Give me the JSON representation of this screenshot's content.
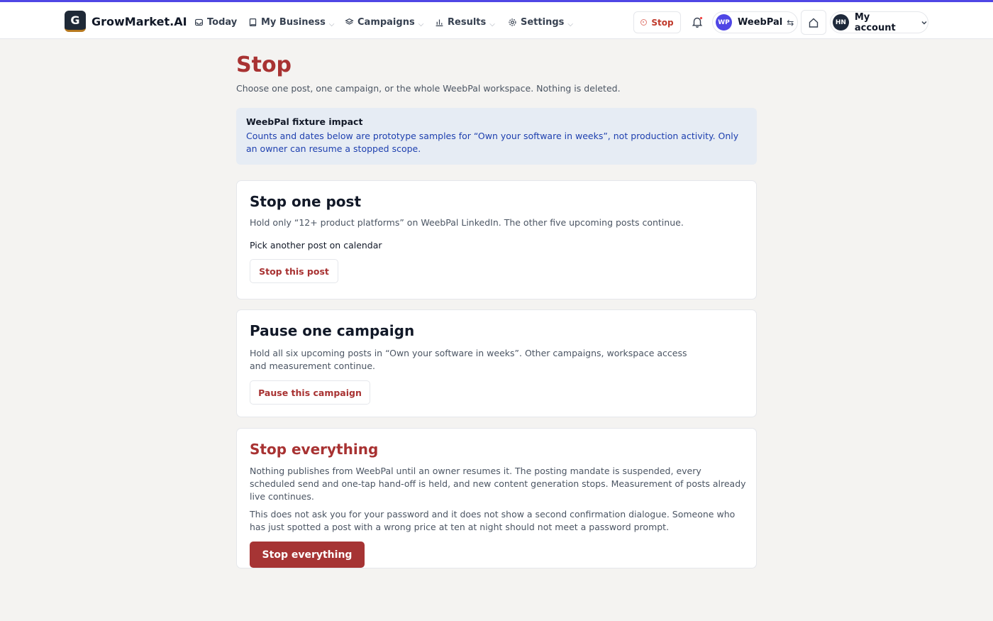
{
  "header": {
    "brand_initial": "G",
    "brand_name": "GrowMarket.AI",
    "nav": [
      {
        "label": "Today",
        "icon": "inbox-icon"
      },
      {
        "label": "My Business",
        "icon": "book-icon"
      },
      {
        "label": "Campaigns",
        "icon": "layers-icon"
      },
      {
        "label": "Results",
        "icon": "bar-chart-icon"
      },
      {
        "label": "Settings",
        "icon": "gear-icon"
      }
    ],
    "stop_label": "Stop",
    "workspace": {
      "initials": "WP",
      "name": "WeebPal"
    },
    "account": {
      "initials": "HN",
      "label": "My account"
    }
  },
  "page": {
    "title": "Stop",
    "subtitle": "Choose one post, one campaign, or the whole WeebPal workspace. Nothing is deleted."
  },
  "notice": {
    "title": "WeebPal fixture impact",
    "body": "Counts and dates below are prototype samples for “Own your software in weeks”, not production activity. Only an owner can resume a stopped scope."
  },
  "cards": {
    "post": {
      "title": "Stop one post",
      "text": "Hold only “12+ product platforms” on WeebPal LinkedIn. The other five upcoming posts continue.",
      "link": "Pick another post on calendar",
      "button": "Stop this post"
    },
    "campaign": {
      "title": "Pause one campaign",
      "text": "Hold all six upcoming posts in “Own your software in weeks”. Other campaigns, workspace access and measurement continue.",
      "button": "Pause this campaign"
    },
    "everything": {
      "title": "Stop everything",
      "text1": "Nothing publishes from WeebPal until an owner resumes it. The posting mandate is suspended, every scheduled send and one-tap hand-off is held, and new content generation stops. Measurement of posts already live continues.",
      "text2": "This does not ask you for your password and it does not show a second confirmation dialogue. Someone who has just spotted a post with a wrong price at ten at night should not meet a password prompt.",
      "button": "Stop everything"
    }
  },
  "colors": {
    "accent": "#a83232",
    "brand_bar": "#4f46e5",
    "notice_bg": "#e6ecf4",
    "notice_text": "#1e40af"
  }
}
